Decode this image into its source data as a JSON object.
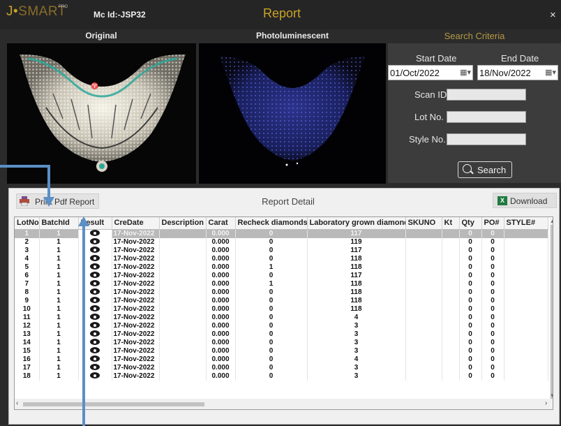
{
  "app": {
    "logo_mark": "J",
    "logo_dot": "•",
    "logo_word": "SMART",
    "logo_pro": "PRO",
    "machine_id": "Mc Id:-JSP32",
    "window_title": "Report",
    "close_glyph": "×"
  },
  "panels": {
    "original_label": "Original",
    "photoluminescent_label": "Photoluminescent"
  },
  "criteria": {
    "title": "Search Criteria",
    "start_label": "Start Date",
    "end_label": "End Date",
    "start_value": "01/Oct/2022",
    "end_value": "18/Nov/2022",
    "scan_id_label": "Scan ID",
    "lot_no_label": "Lot No.",
    "style_no_label": "Style No.",
    "scan_id_value": "",
    "lot_no_value": "",
    "style_no_value": "",
    "search_label": "Search"
  },
  "report": {
    "print_label": "Print Pdf Report",
    "title": "Report Detail",
    "download_label": "Download",
    "excel_glyph": "X"
  },
  "table": {
    "columns": [
      "LotNo",
      "BatchId",
      "Result",
      "CreDate",
      "Description",
      "Carat",
      "Recheck diamonds",
      "Laboratory grown diamonds",
      "SKUNO",
      "Kt",
      "Qty",
      "PO#",
      "STYLE#"
    ],
    "rows": [
      {
        "lot": "1",
        "batch": "1",
        "date": "17-Nov-2022",
        "desc": "",
        "carat": "0.000",
        "recheck": "0",
        "lab": "117",
        "sku": "",
        "kt": "",
        "qty": "0",
        "po": "0",
        "style": ""
      },
      {
        "lot": "2",
        "batch": "1",
        "date": "17-Nov-2022",
        "desc": "",
        "carat": "0.000",
        "recheck": "0",
        "lab": "119",
        "sku": "",
        "kt": "",
        "qty": "0",
        "po": "0",
        "style": ""
      },
      {
        "lot": "3",
        "batch": "1",
        "date": "17-Nov-2022",
        "desc": "",
        "carat": "0.000",
        "recheck": "0",
        "lab": "117",
        "sku": "",
        "kt": "",
        "qty": "0",
        "po": "0",
        "style": ""
      },
      {
        "lot": "4",
        "batch": "1",
        "date": "17-Nov-2022",
        "desc": "",
        "carat": "0.000",
        "recheck": "0",
        "lab": "118",
        "sku": "",
        "kt": "",
        "qty": "0",
        "po": "0",
        "style": ""
      },
      {
        "lot": "5",
        "batch": "1",
        "date": "17-Nov-2022",
        "desc": "",
        "carat": "0.000",
        "recheck": "1",
        "lab": "118",
        "sku": "",
        "kt": "",
        "qty": "0",
        "po": "0",
        "style": ""
      },
      {
        "lot": "6",
        "batch": "1",
        "date": "17-Nov-2022",
        "desc": "",
        "carat": "0.000",
        "recheck": "0",
        "lab": "117",
        "sku": "",
        "kt": "",
        "qty": "0",
        "po": "0",
        "style": ""
      },
      {
        "lot": "7",
        "batch": "1",
        "date": "17-Nov-2022",
        "desc": "",
        "carat": "0.000",
        "recheck": "1",
        "lab": "118",
        "sku": "",
        "kt": "",
        "qty": "0",
        "po": "0",
        "style": ""
      },
      {
        "lot": "8",
        "batch": "1",
        "date": "17-Nov-2022",
        "desc": "",
        "carat": "0.000",
        "recheck": "0",
        "lab": "118",
        "sku": "",
        "kt": "",
        "qty": "0",
        "po": "0",
        "style": ""
      },
      {
        "lot": "9",
        "batch": "1",
        "date": "17-Nov-2022",
        "desc": "",
        "carat": "0.000",
        "recheck": "0",
        "lab": "118",
        "sku": "",
        "kt": "",
        "qty": "0",
        "po": "0",
        "style": ""
      },
      {
        "lot": "10",
        "batch": "1",
        "date": "17-Nov-2022",
        "desc": "",
        "carat": "0.000",
        "recheck": "0",
        "lab": "118",
        "sku": "",
        "kt": "",
        "qty": "0",
        "po": "0",
        "style": ""
      },
      {
        "lot": "11",
        "batch": "1",
        "date": "17-Nov-2022",
        "desc": "",
        "carat": "0.000",
        "recheck": "0",
        "lab": "4",
        "sku": "",
        "kt": "",
        "qty": "0",
        "po": "0",
        "style": ""
      },
      {
        "lot": "12",
        "batch": "1",
        "date": "17-Nov-2022",
        "desc": "",
        "carat": "0.000",
        "recheck": "0",
        "lab": "3",
        "sku": "",
        "kt": "",
        "qty": "0",
        "po": "0",
        "style": ""
      },
      {
        "lot": "13",
        "batch": "1",
        "date": "17-Nov-2022",
        "desc": "",
        "carat": "0.000",
        "recheck": "0",
        "lab": "3",
        "sku": "",
        "kt": "",
        "qty": "0",
        "po": "0",
        "style": ""
      },
      {
        "lot": "14",
        "batch": "1",
        "date": "17-Nov-2022",
        "desc": "",
        "carat": "0.000",
        "recheck": "0",
        "lab": "3",
        "sku": "",
        "kt": "",
        "qty": "0",
        "po": "0",
        "style": ""
      },
      {
        "lot": "15",
        "batch": "1",
        "date": "17-Nov-2022",
        "desc": "",
        "carat": "0.000",
        "recheck": "0",
        "lab": "3",
        "sku": "",
        "kt": "",
        "qty": "0",
        "po": "0",
        "style": ""
      },
      {
        "lot": "16",
        "batch": "1",
        "date": "17-Nov-2022",
        "desc": "",
        "carat": "0.000",
        "recheck": "0",
        "lab": "4",
        "sku": "",
        "kt": "",
        "qty": "0",
        "po": "0",
        "style": ""
      },
      {
        "lot": "17",
        "batch": "1",
        "date": "17-Nov-2022",
        "desc": "",
        "carat": "0.000",
        "recheck": "0",
        "lab": "3",
        "sku": "",
        "kt": "",
        "qty": "0",
        "po": "0",
        "style": ""
      },
      {
        "lot": "18",
        "batch": "1",
        "date": "17-Nov-2022",
        "desc": "",
        "carat": "0.000",
        "recheck": "0",
        "lab": "3",
        "sku": "",
        "kt": "",
        "qty": "0",
        "po": "0",
        "style": ""
      }
    ]
  },
  "icons": {
    "result_icon": "eye-icon",
    "print_icon": "printer-icon",
    "download_icon": "excel-icon",
    "search_icon": "magnifier-icon",
    "calendar_icon": "calendar-icon"
  },
  "colors": {
    "accent_gold": "#c9a227",
    "selected_row": "#b9b9b9",
    "annotation_arrow": "#5b8fc6"
  }
}
